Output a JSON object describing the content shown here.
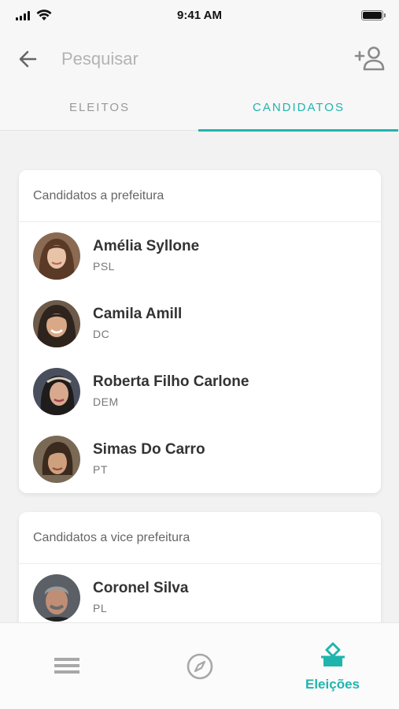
{
  "status_bar": {
    "time": "9:41 AM"
  },
  "header": {
    "search_placeholder": "Pesquisar"
  },
  "tabs": [
    {
      "label": "ELEITOS",
      "active": false
    },
    {
      "label": "CANDIDATOS",
      "active": true
    }
  ],
  "sections": [
    {
      "title": "Candidatos a prefeitura",
      "candidates": [
        {
          "name": "Amélia Syllone",
          "party": "PSL"
        },
        {
          "name": "Camila Amill",
          "party": "DC"
        },
        {
          "name": "Roberta Filho Carlone",
          "party": "DEM"
        },
        {
          "name": "Simas Do Carro",
          "party": "PT"
        }
      ]
    },
    {
      "title": "Candidatos a vice prefeitura",
      "candidates": [
        {
          "name": "Coronel Silva",
          "party": "PL"
        }
      ]
    }
  ],
  "bottom_nav": {
    "items": [
      {
        "icon": "menu-icon",
        "label": "",
        "active": false
      },
      {
        "icon": "compass-icon",
        "label": "",
        "active": false
      },
      {
        "icon": "ballot-icon",
        "label": "Eleições",
        "active": true
      }
    ]
  },
  "colors": {
    "accent": "#1fb5ad",
    "inactive": "#999999",
    "background": "#f2f2f2"
  }
}
